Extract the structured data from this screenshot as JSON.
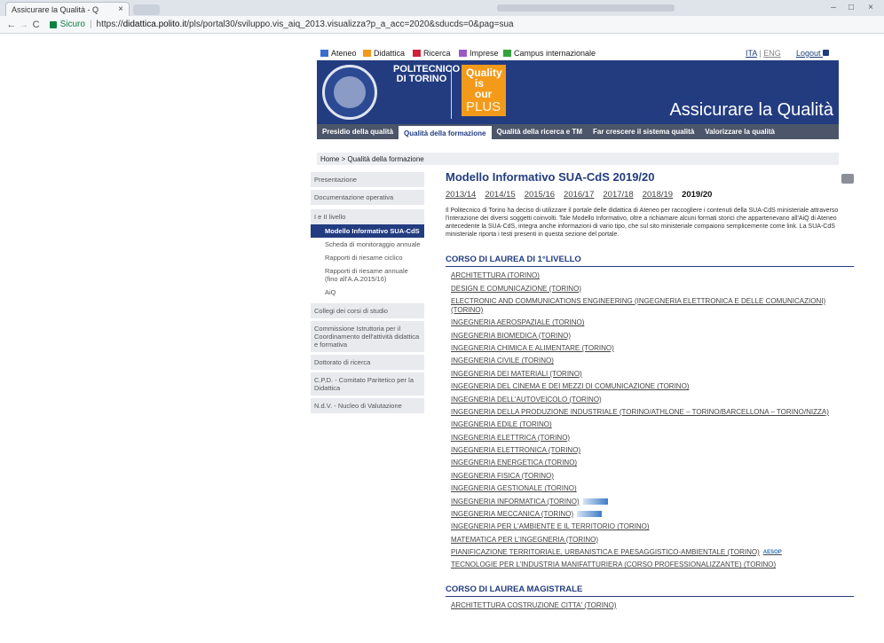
{
  "browser": {
    "tab_title": "Assicurare la Qualità - Q",
    "tab_close": "×",
    "secure_label": "Sicuro",
    "url_prefix": "https://",
    "url_host": "didattica.polito.it",
    "url_path": "/pls/portal30/sviluppo.vis_aiq_2013.visualizza?p_a_acc=2020&sducds=0&pag=sua"
  },
  "topnav": {
    "items": [
      {
        "label": "Ateneo",
        "color": "#3a6fd0"
      },
      {
        "label": "Didattica",
        "color": "#f39a1b"
      },
      {
        "label": "Ricerca",
        "color": "#d0203a"
      },
      {
        "label": "Imprese",
        "color": "#9b59c6"
      },
      {
        "label": "Campus internazionale",
        "color": "#36a23c"
      }
    ],
    "lang_ita": "ITA",
    "lang_sep": "|",
    "lang_eng": "ENG",
    "logout": "Logout"
  },
  "banner": {
    "institution_line1": "POLITECNICO",
    "institution_line2": "DI TORINO",
    "quality_line1": "Quality",
    "quality_line2": "is our",
    "quality_line3": "PLUS",
    "title": "Assicurare la Qualità"
  },
  "mainnav": [
    {
      "label": "Presidio della qualità",
      "active": false
    },
    {
      "label": "Qualità della formazione",
      "active": true
    },
    {
      "label": "Qualità della ricerca e TM",
      "active": false
    },
    {
      "label": "Far crescere il sistema qualità",
      "active": false
    },
    {
      "label": "Valorizzare la qualità",
      "active": false
    }
  ],
  "breadcrumb": "Home > Qualità della formazione",
  "sidebar": {
    "presentazione": "Presentazione",
    "documentazione": "Documentazione operativa",
    "livello_head": "I e II livello",
    "livello_items": [
      "Modello Informativo SUA-CdS",
      "Scheda di monitoraggio annuale",
      "Rapporti di riesame ciclico",
      "Rapporti di riesame annuale (fino all'A.A.2015/16)",
      "AiQ"
    ],
    "collegi": "Collegi dei corsi di studio",
    "commissione": "Commissione Istruttoria per il Coordinamento dell'attività didattica e formativa",
    "dottorato": "Dottorato di ricerca",
    "cpd": "C.P.D. - Comitato Paritetico per la Didattica",
    "ndv": "N.d.V. - Nucleo di Valutazione"
  },
  "content": {
    "title": "Modello Informativo SUA-CdS 2019/20",
    "years": [
      "2013/14",
      "2014/15",
      "2015/16",
      "2016/17",
      "2017/18",
      "2018/19"
    ],
    "current_year": "2019/20",
    "intro": "Il Politecnico di Torino ha deciso di utilizzare il portale delle didattica di Ateneo per raccogliere i contenuti della SUA-CdS ministeriale attraverso l'interazione dei diversi soggetti coinvolti. Tale Modello Informativo, oltre a richiamare alcuni formati storici che appartenevano all'AiQ di Ateneo antecedente la SUA-CdS, integra anche informazioni di vario tipo, che sul sito ministeriale compaiono semplicemente come link. La SUA-CdS ministeriale riporta i testi presenti in questa sezione del portale.",
    "section1": "CORSO DI LAUREA DI 1°LIVELLO",
    "courses": [
      "ARCHITETTURA (TORINO)",
      "DESIGN E COMUNICAZIONE (TORINO)",
      "ELECTRONIC AND COMMUNICATIONS ENGINEERING (INGEGNERIA ELETTRONICA E DELLE COMUNICAZIONI) (TORINO)",
      "INGEGNERIA AEROSPAZIALE (TORINO)",
      "INGEGNERIA BIOMEDICA (TORINO)",
      "INGEGNERIA CHIMICA E ALIMENTARE (TORINO)",
      "INGEGNERIA CIVILE (TORINO)",
      "INGEGNERIA DEI MATERIALI (TORINO)",
      "INGEGNERIA DEL CINEMA E DEI MEZZI DI COMUNICAZIONE (TORINO)",
      "INGEGNERIA DELL'AUTOVEICOLO (TORINO)",
      "INGEGNERIA DELLA PRODUZIONE INDUSTRIALE (TORINO/ATHLONE – TORINO/BARCELLONA – TORINO/NIZZA)",
      "INGEGNERIA EDILE (TORINO)",
      "INGEGNERIA ELETTRICA (TORINO)",
      "INGEGNERIA ELETTRONICA (TORINO)",
      "INGEGNERIA ENERGETICA (TORINO)",
      "INGEGNERIA FISICA (TORINO)",
      "INGEGNERIA GESTIONALE (TORINO)",
      "INGEGNERIA INFORMATICA (TORINO)",
      "INGEGNERIA MECCANICA (TORINO)",
      "INGEGNERIA PER L'AMBIENTE E IL TERRITORIO (TORINO)",
      "MATEMATICA PER L'INGEGNERIA (TORINO)",
      "PIANIFICAZIONE TERRITORIALE, URBANISTICA E PAESAGGISTICO-AMBIENTALE (TORINO)",
      "TECNOLOGIE PER L'INDUSTRIA MANIFATTURIERA (CORSO PROFESSIONALIZZANTE) (TORINO)"
    ],
    "esop_label": "AESOP",
    "section2": "CORSO DI LAUREA MAGISTRALE",
    "courses2": [
      "ARCHITETTURA COSTRUZIONE CITTA' (TORINO)"
    ]
  }
}
